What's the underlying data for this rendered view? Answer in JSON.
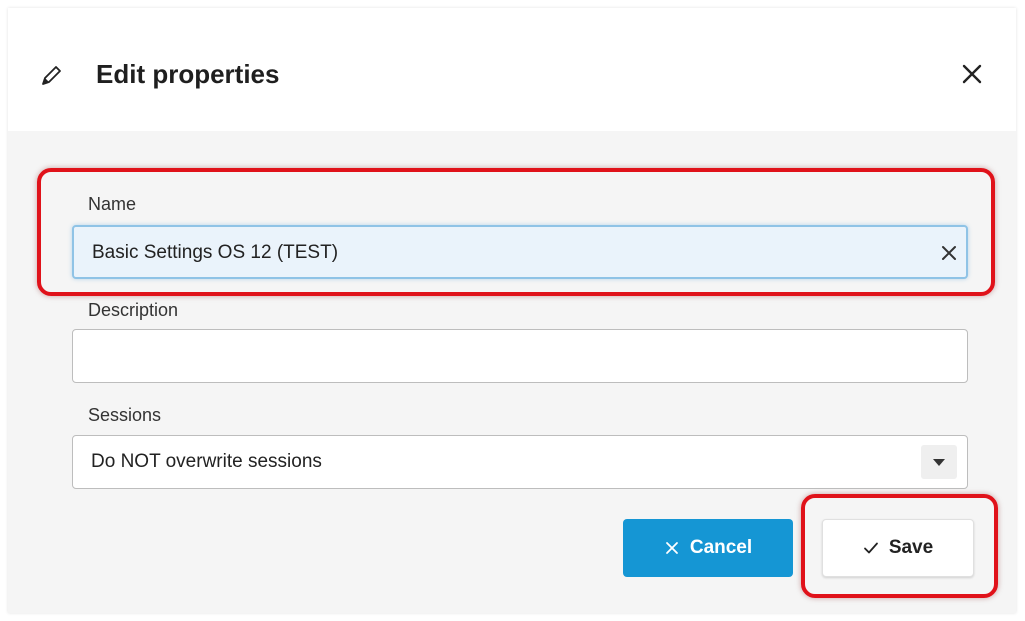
{
  "dialog": {
    "title": "Edit properties",
    "header_icon": "pencil-icon",
    "close_icon": "close-icon"
  },
  "fields": {
    "name": {
      "label": "Name",
      "value": "Basic Settings OS 12 (TEST)",
      "clear_icon": "clear-icon"
    },
    "description": {
      "label": "Description",
      "value": ""
    },
    "sessions": {
      "label": "Sessions",
      "value": "Do NOT overwrite sessions",
      "dropdown_icon": "caret-down-icon"
    }
  },
  "buttons": {
    "cancel": {
      "label": "Cancel",
      "icon": "x-icon",
      "color": "#1596d4"
    },
    "save": {
      "label": "Save",
      "icon": "check-icon"
    }
  },
  "colors": {
    "annotation": "#e0121a",
    "focus_border": "#8fc3e6",
    "focus_background": "#eaf3fb"
  }
}
